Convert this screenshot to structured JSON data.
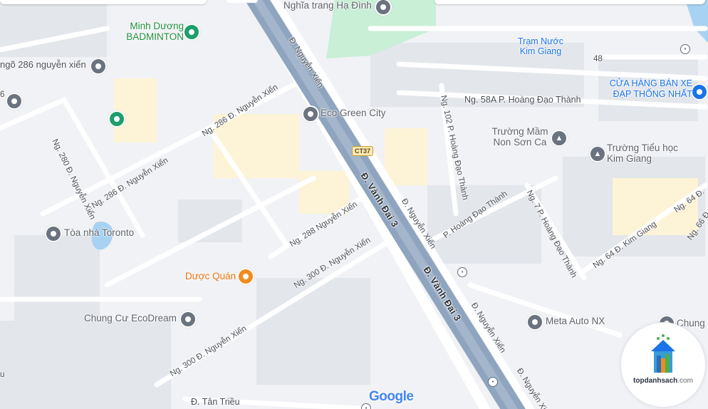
{
  "roads": {
    "vanh_dai_upper": "Đ. Vành Đai 3",
    "vanh_dai_lower": "Đ. Vành Đai 3",
    "nguyen_xien_a": "Đ. Nguyễn Xiển",
    "nguyen_xien_b": "Đ. Nguyễn Xiển",
    "nguyen_xien_c": "Đ. Nguyễn Xiển",
    "nguyen_xien_d": "Đ. Nguyễn Xiển",
    "ng286_a": "Ng. 286 Đ. Nguyễn Xiển",
    "ng286_b": "Ng. 286 Đ. Nguyễn Xiển",
    "ng280": "Ng. 280 Đ. Nguyễn Xiển",
    "ng288": "Ng. 288 Nguyễn Xiển",
    "ng300_a": "Ng. 300 Đ. Nguyễn Xiển",
    "ng300_b": "Ng. 300 Đ. Nguyễn Xiển",
    "ng58a": "Ng. 58A P. Hoàng Đạo Thành",
    "ng102": "Ng. 102 P. Hoàng Đạo Thành",
    "p_hoang": "P. Hoàng Đạo Thành",
    "ng7": "Ng. 7 P. Hoàng Đạo Thành",
    "ng64": "Ng. 64 Đ. Kim Giang",
    "ng64_right": "Ng. 64 Đ.",
    "ng66": "Ng. 66 Đ.",
    "tan_trieu": "Đ. Tân Triều",
    "go286": "ngõ 286 nguyễn xiển",
    "num48": "48",
    "edge_u": "u",
    "edge_6": "6"
  },
  "shield": "CT37",
  "places": {
    "nghia_trang": "Nghĩa trang Hạ Đình",
    "tram_nuoc": "Trạm Nước Kim Giang",
    "minh_duong": "Minh Dương BADMINTON",
    "cua_hang": "CỬA HÀNG BÁN XE ĐẠP THỐNG NHẤT",
    "eco_green": "Eco Green City",
    "truong_mam_non": "Trường Mầm Non Sơn Ca",
    "truong_tieu_hoc": "Trường Tiểu học Kim Giang",
    "toa_nha": "Tòa nhà Toronto",
    "duoc_quan": "Dược Quán",
    "chung_cu": "Chung Cư EcoDream",
    "meta_auto": "Meta Auto NX",
    "chung_edge": "Chung"
  },
  "colors": {
    "highway": "#8ea4bf",
    "road": "#ffffff",
    "building": "#e2e5ea",
    "park": "#c9efd6",
    "water": "#a8d2f2",
    "yellow_block": "#fdf3d6",
    "poi_green": "#1e9e6b",
    "poi_orange": "#f08c1e",
    "poi_blue": "#1a73e8",
    "poi_gray": "#6b7380"
  },
  "branding": {
    "google": "Google",
    "watermark_main": "topdanhsach",
    "watermark_tld": ".com"
  },
  "icons": [
    "place-pin-icon",
    "school-icon",
    "restaurant-icon",
    "shopping-bag-icon",
    "bus-stop-icon",
    "cemetery-icon",
    "badminton-icon"
  ]
}
